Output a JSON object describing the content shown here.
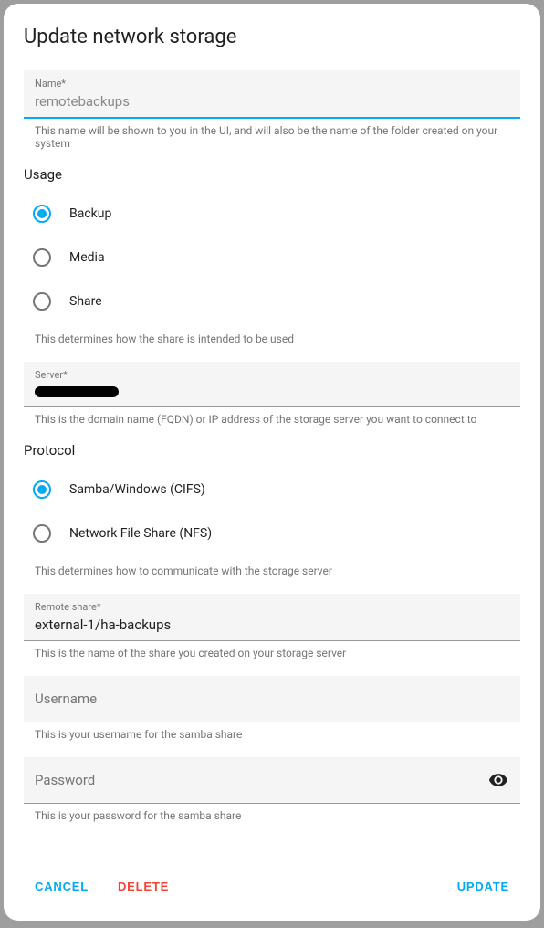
{
  "dialog": {
    "title": "Update network storage"
  },
  "name_field": {
    "label": "Name*",
    "value": "remotebackups",
    "helper": "This name will be shown to you in the UI, and will also be the name of the folder created on your system"
  },
  "usage": {
    "section_label": "Usage",
    "options": [
      {
        "label": "Backup",
        "selected": true
      },
      {
        "label": "Media",
        "selected": false
      },
      {
        "label": "Share",
        "selected": false
      }
    ],
    "helper": "This determines how the share is intended to be used"
  },
  "server_field": {
    "label": "Server*",
    "value_redacted": true,
    "helper": "This is the domain name (FQDN) or IP address of the storage server you want to connect to"
  },
  "protocol": {
    "section_label": "Protocol",
    "options": [
      {
        "label": "Samba/Windows (CIFS)",
        "selected": true
      },
      {
        "label": "Network File Share (NFS)",
        "selected": false
      }
    ],
    "helper": "This determines how to communicate with the storage server"
  },
  "remote_share_field": {
    "label": "Remote share*",
    "value": "external-1/ha-backups",
    "helper": "This is the name of the share you created on your storage server"
  },
  "username_field": {
    "placeholder": "Username",
    "helper": "This is your username for the samba share"
  },
  "password_field": {
    "placeholder": "Password",
    "helper": "This is your password for the samba share"
  },
  "actions": {
    "cancel": "CANCEL",
    "delete": "DELETE",
    "update": "UPDATE"
  }
}
